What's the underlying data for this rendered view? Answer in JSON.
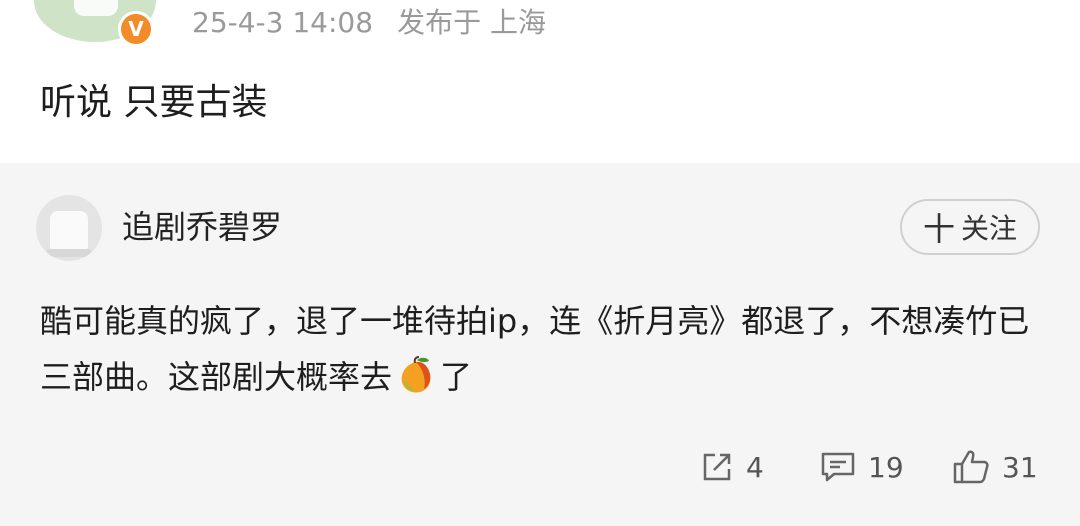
{
  "post": {
    "date": "25-4-3 14:08",
    "location": "发布于 上海",
    "text": "听说 只要古装"
  },
  "reply": {
    "username": "追剧乔碧罗",
    "follow_plus": "十",
    "follow_label": "关注",
    "text_before_emoji": "酷可能真的疯了，退了一堆待拍ip，连《折月亮》都退了，不想凑竹已三部曲。这部剧大概率去",
    "emoji": "mango",
    "text_after_emoji": "了",
    "share_count": "4",
    "comment_count": "19",
    "like_count": "31"
  },
  "colors": {
    "badge": "#f28c28",
    "reply_background": "#f5f5f5",
    "meta_text": "#9a9a9a"
  },
  "icons": [
    "verified-badge-icon",
    "share-icon",
    "comment-icon",
    "like-icon",
    "mango-emoji"
  ]
}
